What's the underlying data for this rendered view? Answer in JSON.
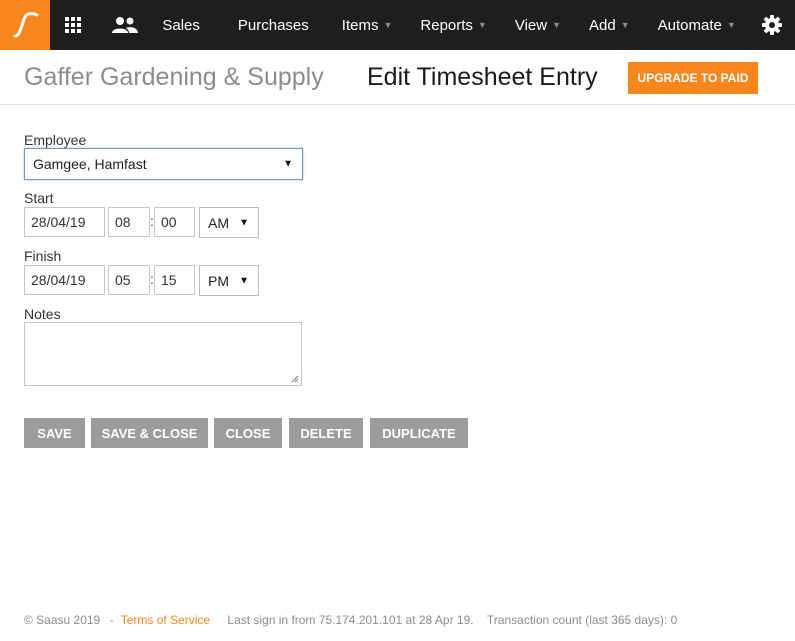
{
  "nav": {
    "items": [
      {
        "label": "Sales",
        "has_caret": false
      },
      {
        "label": "Purchases",
        "has_caret": false
      },
      {
        "label": "Items",
        "has_caret": true
      },
      {
        "label": "Reports",
        "has_caret": true
      },
      {
        "label": "View",
        "has_caret": true
      },
      {
        "label": "Add",
        "has_caret": true
      },
      {
        "label": "Automate",
        "has_caret": true
      }
    ],
    "caret": "▼",
    "icons": [
      "saasu-logo-icon",
      "apps-grid-icon",
      "contacts-people-icon",
      "gear-icon"
    ]
  },
  "header": {
    "company": "Gaffer Gardening & Supply",
    "title": "Edit Timesheet Entry",
    "upgrade_label": "UPGRADE TO PAID"
  },
  "form": {
    "employee_label": "Employee",
    "employee_value": "Gamgee, Hamfast",
    "start_label": "Start",
    "start": {
      "date": "28/04/19",
      "hour": "08",
      "minute": "00",
      "ampm": "AM"
    },
    "finish_label": "Finish",
    "finish": {
      "date": "28/04/19",
      "hour": "05",
      "minute": "15",
      "ampm": "PM"
    },
    "time_sep": ":",
    "dropdown_arrow": "▼",
    "notes_label": "Notes",
    "notes_value": ""
  },
  "buttons": {
    "save": "SAVE",
    "save_close": "SAVE & CLOSE",
    "close": "CLOSE",
    "delete": "DELETE",
    "duplicate": "DUPLICATE"
  },
  "footer": {
    "copyright": "© Saasu 2019",
    "sep": "-",
    "terms": "Terms of Service",
    "last_sign_in": "Last sign in from 75.174.201.101 at 28 Apr 19.",
    "transaction_count": "Transaction count (last 365 days): 0"
  },
  "colors": {
    "accent": "#f7861d",
    "nav_bg": "#1e1e1e",
    "button_gray": "#9c9c9c"
  }
}
